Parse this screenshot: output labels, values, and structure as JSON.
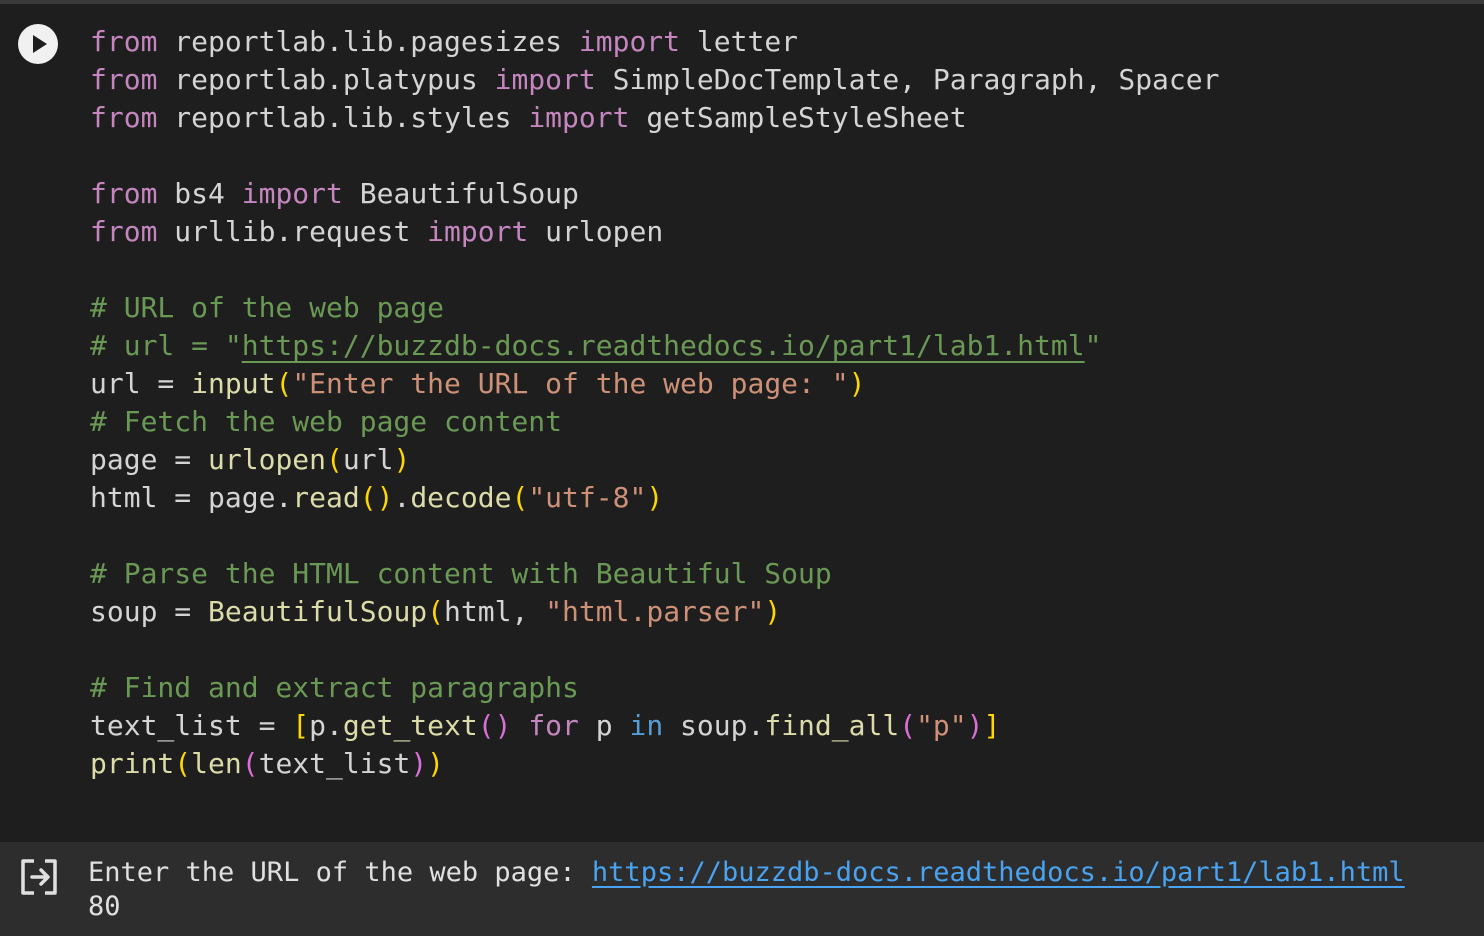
{
  "cell": {
    "run_icon": "play-icon",
    "code_lines": [
      [
        {
          "t": "from",
          "c": "kw"
        },
        {
          "t": " reportlab.lib.pagesizes "
        },
        {
          "t": "import",
          "c": "kw"
        },
        {
          "t": " letter"
        }
      ],
      [
        {
          "t": "from",
          "c": "kw"
        },
        {
          "t": " reportlab.platypus "
        },
        {
          "t": "import",
          "c": "kw"
        },
        {
          "t": " SimpleDocTemplate, Paragraph, Spacer"
        }
      ],
      [
        {
          "t": "from",
          "c": "kw"
        },
        {
          "t": " reportlab.lib.styles "
        },
        {
          "t": "import",
          "c": "kw"
        },
        {
          "t": " getSampleStyleSheet"
        }
      ],
      [],
      [
        {
          "t": "from",
          "c": "kw"
        },
        {
          "t": " bs4 "
        },
        {
          "t": "import",
          "c": "kw"
        },
        {
          "t": " BeautifulSoup"
        }
      ],
      [
        {
          "t": "from",
          "c": "kw"
        },
        {
          "t": " urllib.request "
        },
        {
          "t": "import",
          "c": "kw"
        },
        {
          "t": " urlopen"
        }
      ],
      [],
      [
        {
          "t": "# URL of the web page",
          "c": "cm"
        }
      ],
      [
        {
          "t": "# url = \"",
          "c": "cm"
        },
        {
          "t": "https://buzzdb-docs.readthedocs.io/part1/lab1.html",
          "c": "cm cm-link"
        },
        {
          "t": "\"",
          "c": "cm"
        }
      ],
      [
        {
          "t": "url = "
        },
        {
          "t": "input",
          "c": "fn"
        },
        {
          "t": "(",
          "c": "p1"
        },
        {
          "t": "\"Enter the URL of the web page: \"",
          "c": "str"
        },
        {
          "t": ")",
          "c": "p1"
        }
      ],
      [
        {
          "t": "# Fetch the web page content",
          "c": "cm"
        }
      ],
      [
        {
          "t": "page = "
        },
        {
          "t": "urlopen",
          "c": "fn"
        },
        {
          "t": "(",
          "c": "p1"
        },
        {
          "t": "url"
        },
        {
          "t": ")",
          "c": "p1"
        }
      ],
      [
        {
          "t": "html = page."
        },
        {
          "t": "read",
          "c": "fn"
        },
        {
          "t": "()",
          "c": "p1"
        },
        {
          "t": "."
        },
        {
          "t": "decode",
          "c": "fn"
        },
        {
          "t": "(",
          "c": "p1"
        },
        {
          "t": "\"utf-8\"",
          "c": "str"
        },
        {
          "t": ")",
          "c": "p1"
        }
      ],
      [],
      [
        {
          "t": "# Parse the HTML content with Beautiful Soup",
          "c": "cm"
        }
      ],
      [
        {
          "t": "soup = "
        },
        {
          "t": "BeautifulSoup",
          "c": "fn"
        },
        {
          "t": "(",
          "c": "p1"
        },
        {
          "t": "html, "
        },
        {
          "t": "\"html.parser\"",
          "c": "str"
        },
        {
          "t": ")",
          "c": "p1"
        }
      ],
      [],
      [
        {
          "t": "# Find and extract paragraphs",
          "c": "cm"
        }
      ],
      [
        {
          "t": "text_list = "
        },
        {
          "t": "[",
          "c": "p1"
        },
        {
          "t": "p."
        },
        {
          "t": "get_text",
          "c": "fn"
        },
        {
          "t": "()",
          "c": "p2"
        },
        {
          "t": " "
        },
        {
          "t": "for",
          "c": "kw"
        },
        {
          "t": " p "
        },
        {
          "t": "in",
          "c": "in-kw"
        },
        {
          "t": " soup."
        },
        {
          "t": "find_all",
          "c": "fn"
        },
        {
          "t": "(",
          "c": "p2"
        },
        {
          "t": "\"p\"",
          "c": "str"
        },
        {
          "t": ")",
          "c": "p2"
        },
        {
          "t": "]",
          "c": "p1"
        }
      ],
      [
        {
          "t": "print",
          "c": "fn"
        },
        {
          "t": "(",
          "c": "p1"
        },
        {
          "t": "len",
          "c": "fn"
        },
        {
          "t": "(",
          "c": "p2"
        },
        {
          "t": "text_list"
        },
        {
          "t": ")",
          "c": "p2"
        },
        {
          "t": ")",
          "c": "p1"
        }
      ]
    ]
  },
  "output": {
    "icon": "output-exit-icon",
    "prompt": "Enter the URL of the web page: ",
    "link": "https://buzzdb-docs.readthedocs.io/part1/lab1.html",
    "result": "80"
  },
  "colors": {
    "background": "#1e1e1e",
    "output_background": "#2d2d2d",
    "keyword": "#c586c0",
    "function": "#dcdcaa",
    "string": "#ce9178",
    "comment": "#6a9955",
    "link": "#4aa3f0"
  }
}
